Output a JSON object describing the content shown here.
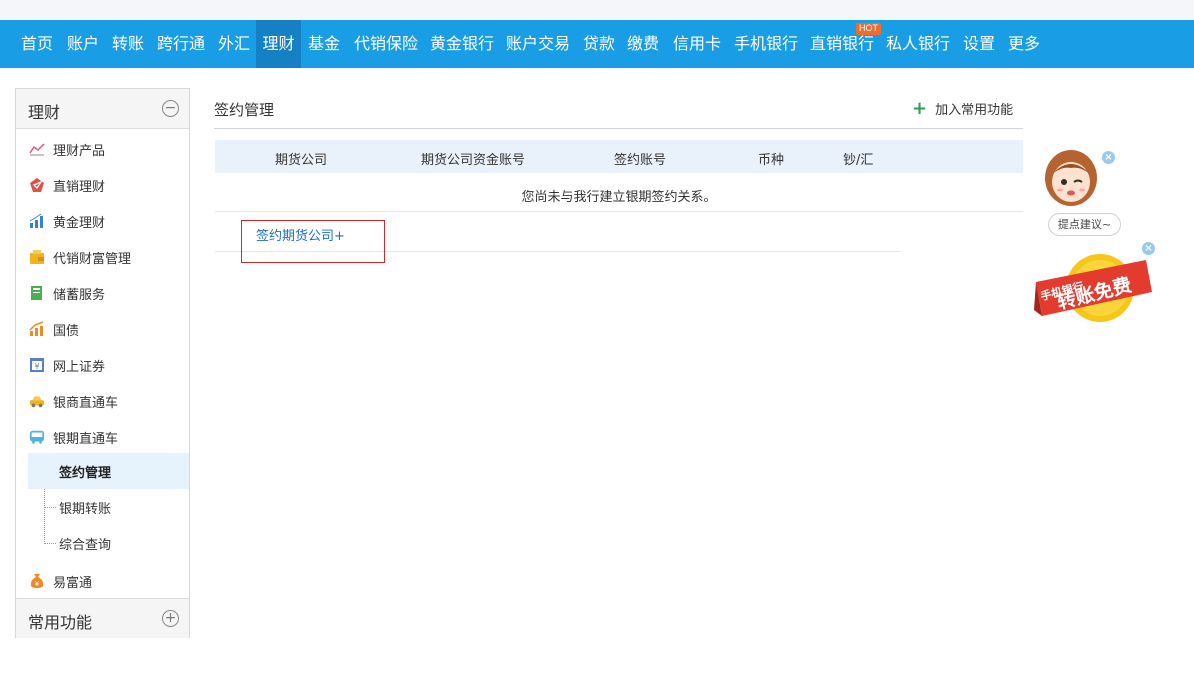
{
  "nav": {
    "items": [
      {
        "label": "首页"
      },
      {
        "label": "账户"
      },
      {
        "label": "转账"
      },
      {
        "label": "跨行通"
      },
      {
        "label": "外汇"
      },
      {
        "label": "理财",
        "active": true
      },
      {
        "label": "基金"
      },
      {
        "label": "代销保险"
      },
      {
        "label": "黄金银行"
      },
      {
        "label": "账户交易"
      },
      {
        "label": "贷款"
      },
      {
        "label": "缴费"
      },
      {
        "label": "信用卡"
      },
      {
        "label": "手机银行"
      },
      {
        "label": "直销银行",
        "badge": "HOT"
      },
      {
        "label": "私人银行"
      },
      {
        "label": "设置"
      },
      {
        "label": "更多"
      }
    ],
    "colors": {
      "bar": "#199ee5",
      "active": "#1580c4",
      "badge": "#f26b2e"
    }
  },
  "sidebar": {
    "section_title": "理财",
    "collapse_symbol": "−",
    "items": [
      {
        "label": "理财产品",
        "icon": "line-chart-icon"
      },
      {
        "label": "直销理财",
        "icon": "red-gem-icon"
      },
      {
        "label": "黄金理财",
        "icon": "bar-chart-icon"
      },
      {
        "label": "代销财富管理",
        "icon": "wallet-icon"
      },
      {
        "label": "储蓄服务",
        "icon": "savings-book-icon"
      },
      {
        "label": "国债",
        "icon": "rising-chart-icon"
      },
      {
        "label": "网上证券",
        "icon": "yen-screen-icon"
      },
      {
        "label": "银商直通车",
        "icon": "car-icon"
      },
      {
        "label": "银期直通车",
        "icon": "bus-icon"
      }
    ],
    "sub_items": [
      {
        "label": "签约管理",
        "active": true
      },
      {
        "label": "银期转账"
      },
      {
        "label": "综合查询"
      }
    ],
    "last_item": {
      "label": "易富通",
      "icon": "money-bag-icon"
    },
    "footer_title": "常用功能",
    "expand_symbol": "+"
  },
  "main": {
    "title": "签约管理",
    "add_favorite": "加入常用功能",
    "table": {
      "headers": [
        "期货公司",
        "期货公司资金账号",
        "签约账号",
        "币种",
        "钞/汇"
      ],
      "empty_message": "您尚未与我行建立银期签约关系。"
    },
    "sign_link": "签约期货公司+"
  },
  "floaters": {
    "suggest": "提点建议~",
    "promo_line1": "手机银行",
    "promo_line2": "转账免费",
    "close": "×"
  }
}
